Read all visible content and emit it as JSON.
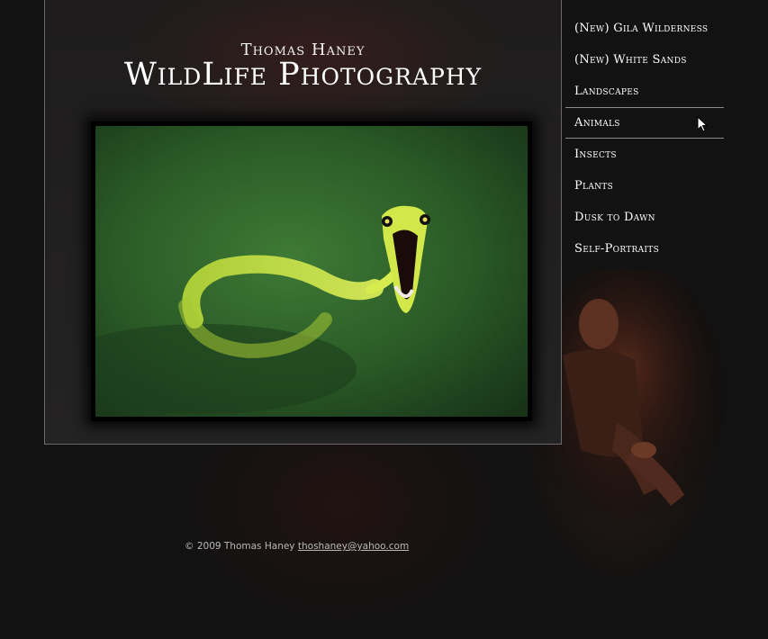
{
  "header": {
    "name": "Thomas Haney",
    "title": "WildLife Photography"
  },
  "nav": {
    "items": [
      {
        "label": "(New) Gila Wilderness"
      },
      {
        "label": "(New) White Sands"
      },
      {
        "label": "Landscapes"
      },
      {
        "label": "Animals",
        "active": true
      },
      {
        "label": "Insects"
      },
      {
        "label": "Plants"
      },
      {
        "label": "Dusk to Dawn"
      },
      {
        "label": "Self-Portraits"
      }
    ]
  },
  "footer": {
    "copyright": "© 2009 Thomas Haney",
    "email": "thoshaney@yahoo.com"
  },
  "colors": {
    "background": "#121212",
    "panel_border": "#6a6a6a",
    "text": "#ffffff",
    "snake": "#c8e040"
  },
  "icons": {
    "cursor": "mouse-pointer-icon"
  }
}
